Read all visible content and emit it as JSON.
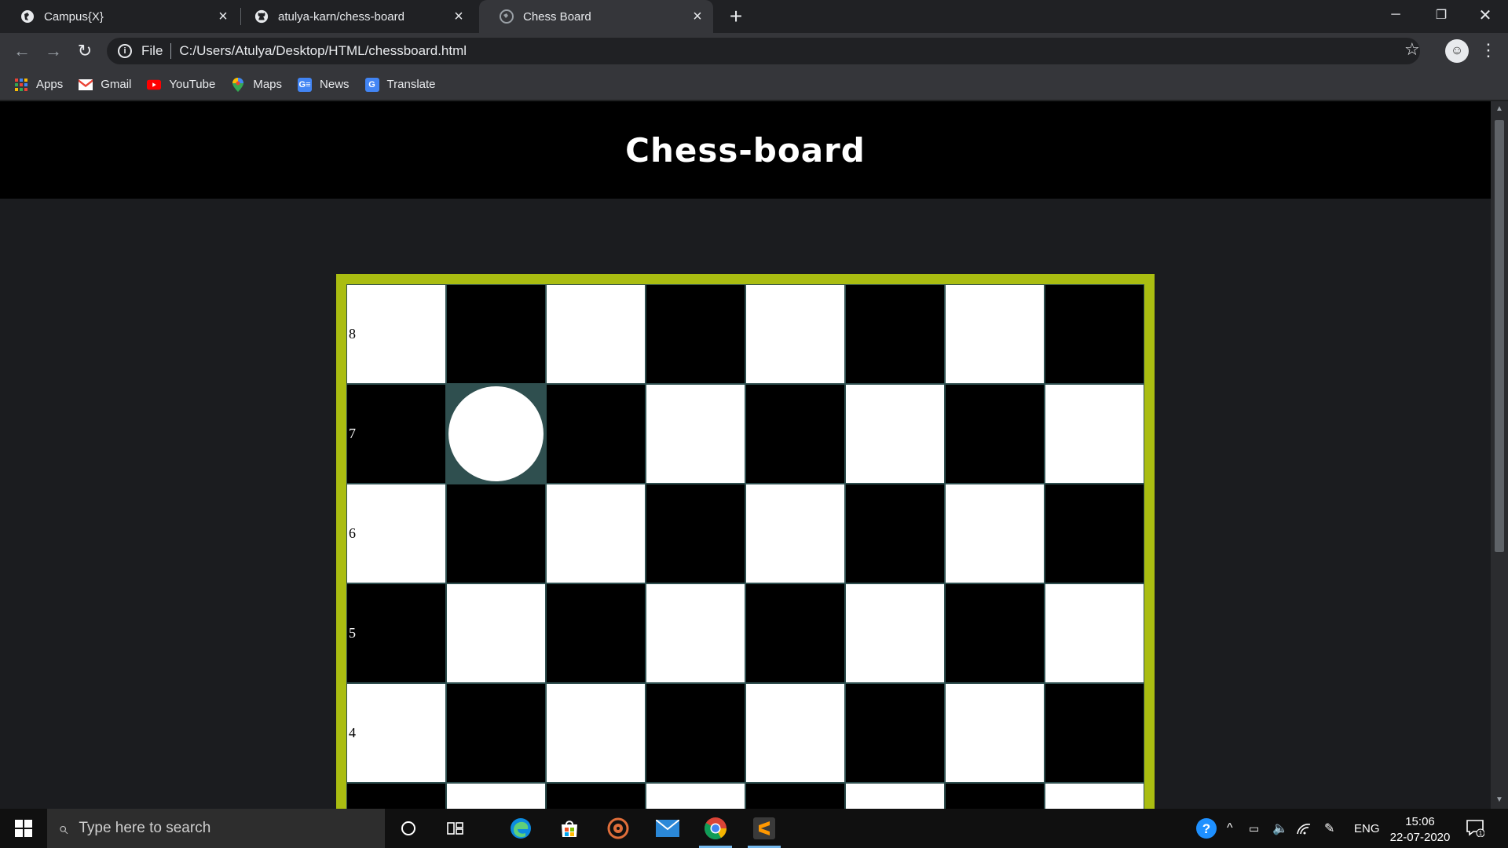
{
  "browser": {
    "tabs": [
      {
        "title": "Campus{X}",
        "favicon": "globe-icon",
        "active": false
      },
      {
        "title": "atulya-karn/chess-board",
        "favicon": "github-icon",
        "active": false
      },
      {
        "title": "Chess Board",
        "favicon": "globe-icon",
        "active": true
      }
    ],
    "new_tab_label": "+",
    "omnibox": {
      "scheme": "File",
      "url": "C:/Users/Atulya/Desktop/HTML/chessboard.html"
    },
    "bookmarks": [
      {
        "label": "Apps",
        "icon": "apps-grid-icon"
      },
      {
        "label": "Gmail",
        "icon": "gmail-icon"
      },
      {
        "label": "YouTube",
        "icon": "youtube-icon"
      },
      {
        "label": "Maps",
        "icon": "maps-icon"
      },
      {
        "label": "News",
        "icon": "news-icon"
      },
      {
        "label": "Translate",
        "icon": "translate-icon"
      }
    ]
  },
  "page": {
    "title": "Chess-board",
    "board": {
      "rank_labels": [
        "8",
        "7",
        "6",
        "5",
        "4"
      ],
      "selected_square": {
        "rank": "7",
        "file_index": 1
      },
      "colors": {
        "frame": "#aabd11",
        "dark": "#000000",
        "light": "#ffffff",
        "selected": "#2f4f4f"
      }
    }
  },
  "taskbar": {
    "search_placeholder": "Type here to search",
    "language": "ENG",
    "time": "15:06",
    "date": "22-07-2020",
    "notification_count": "1"
  }
}
